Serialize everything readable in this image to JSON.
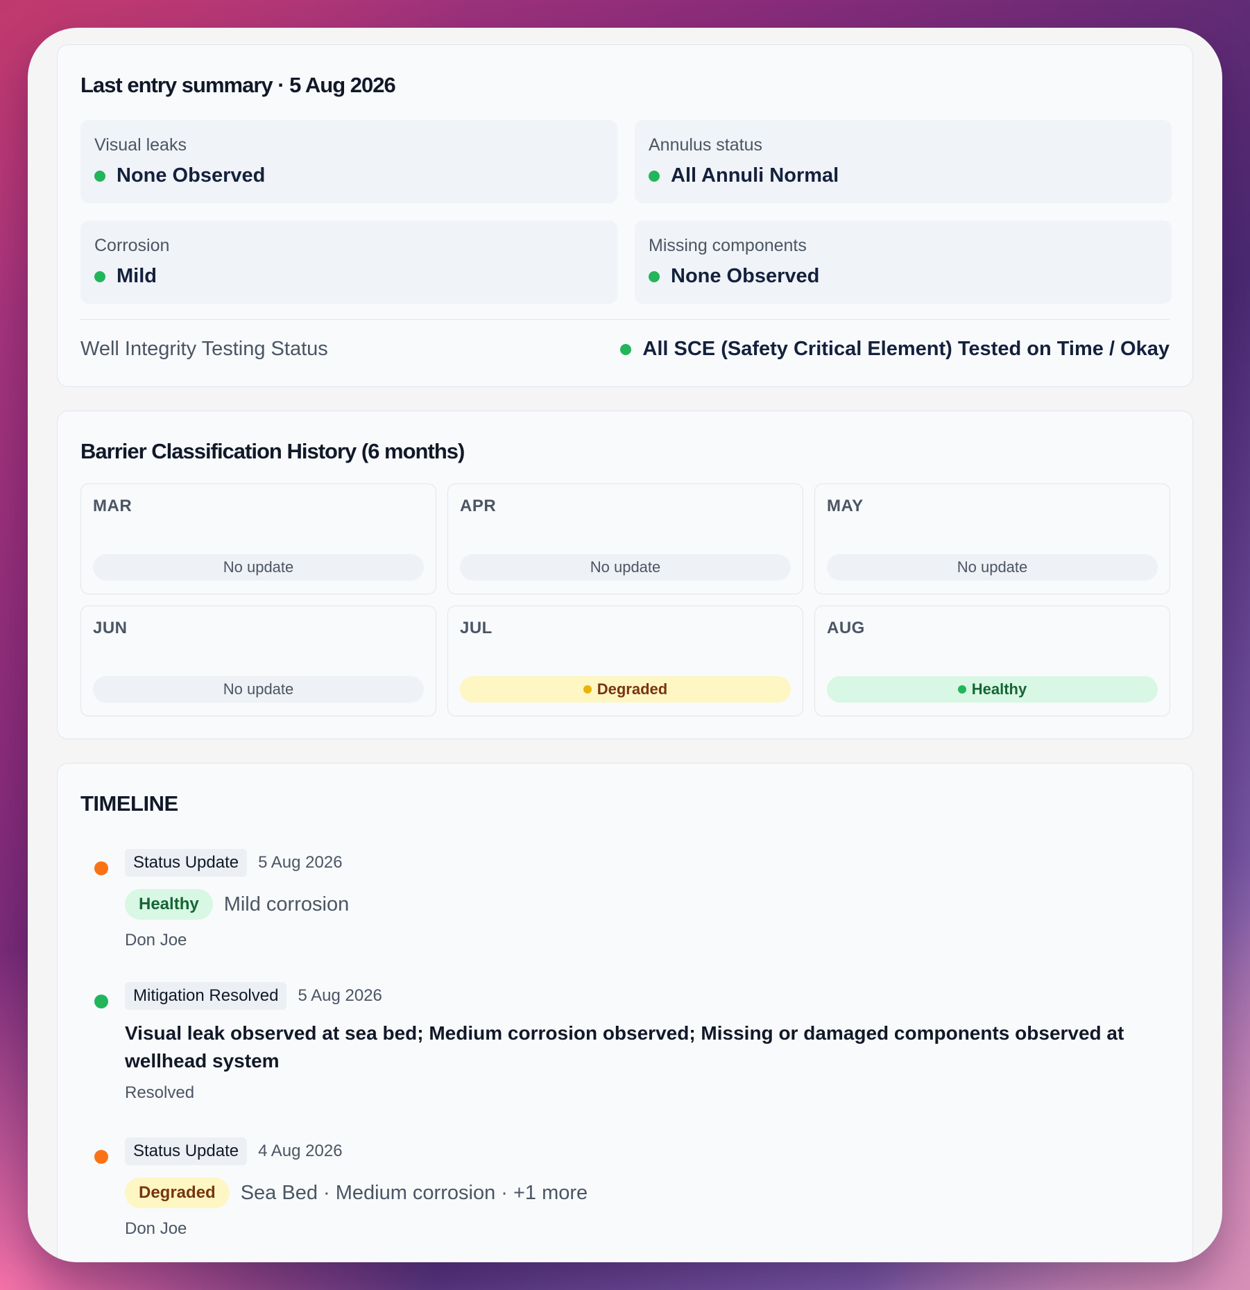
{
  "summary": {
    "title": "Last entry summary · 5 Aug 2026",
    "tiles": [
      {
        "label": "Visual leaks",
        "value": "None Observed",
        "status_color": "#22b55a"
      },
      {
        "label": "Annulus status",
        "value": "All Annuli Normal",
        "status_color": "#22b55a"
      },
      {
        "label": "Corrosion",
        "value": "Mild",
        "status_color": "#22b55a"
      },
      {
        "label": "Missing components",
        "value": "None Observed",
        "status_color": "#22b55a"
      }
    ],
    "testing": {
      "label": "Well Integrity Testing Status",
      "value": "All SCE (Safety Critical Element) Tested on Time / Okay",
      "status_color": "#22b55a"
    }
  },
  "history": {
    "title": "Barrier Classification History (6 months)",
    "months": [
      {
        "name": "MAR",
        "status": "No update",
        "kind": "none"
      },
      {
        "name": "APR",
        "status": "No update",
        "kind": "none"
      },
      {
        "name": "MAY",
        "status": "No update",
        "kind": "none"
      },
      {
        "name": "JUN",
        "status": "No update",
        "kind": "none"
      },
      {
        "name": "JUL",
        "status": "Degraded",
        "kind": "degraded"
      },
      {
        "name": "AUG",
        "status": "Healthy",
        "kind": "healthy"
      }
    ]
  },
  "timeline": {
    "title": "TIMELINE",
    "items": [
      {
        "type": "Status Update",
        "date": "5 Aug 2026",
        "dot": "orange",
        "chip": "Healthy",
        "chip_kind": "healthy",
        "desc": "Mild corrosion",
        "meta": "Don Joe"
      },
      {
        "type": "Mitigation Resolved",
        "date": "5 Aug 2026",
        "dot": "green",
        "text": "Visual leak observed at sea bed; Medium corrosion observed; Missing or damaged components observed at wellhead system",
        "meta": "Resolved"
      },
      {
        "type": "Status Update",
        "date": "4 Aug 2026",
        "dot": "orange",
        "chip": "Degraded",
        "chip_kind": "degraded",
        "desc": "Sea Bed · Medium corrosion · +1 more",
        "meta": "Don Joe"
      }
    ]
  }
}
